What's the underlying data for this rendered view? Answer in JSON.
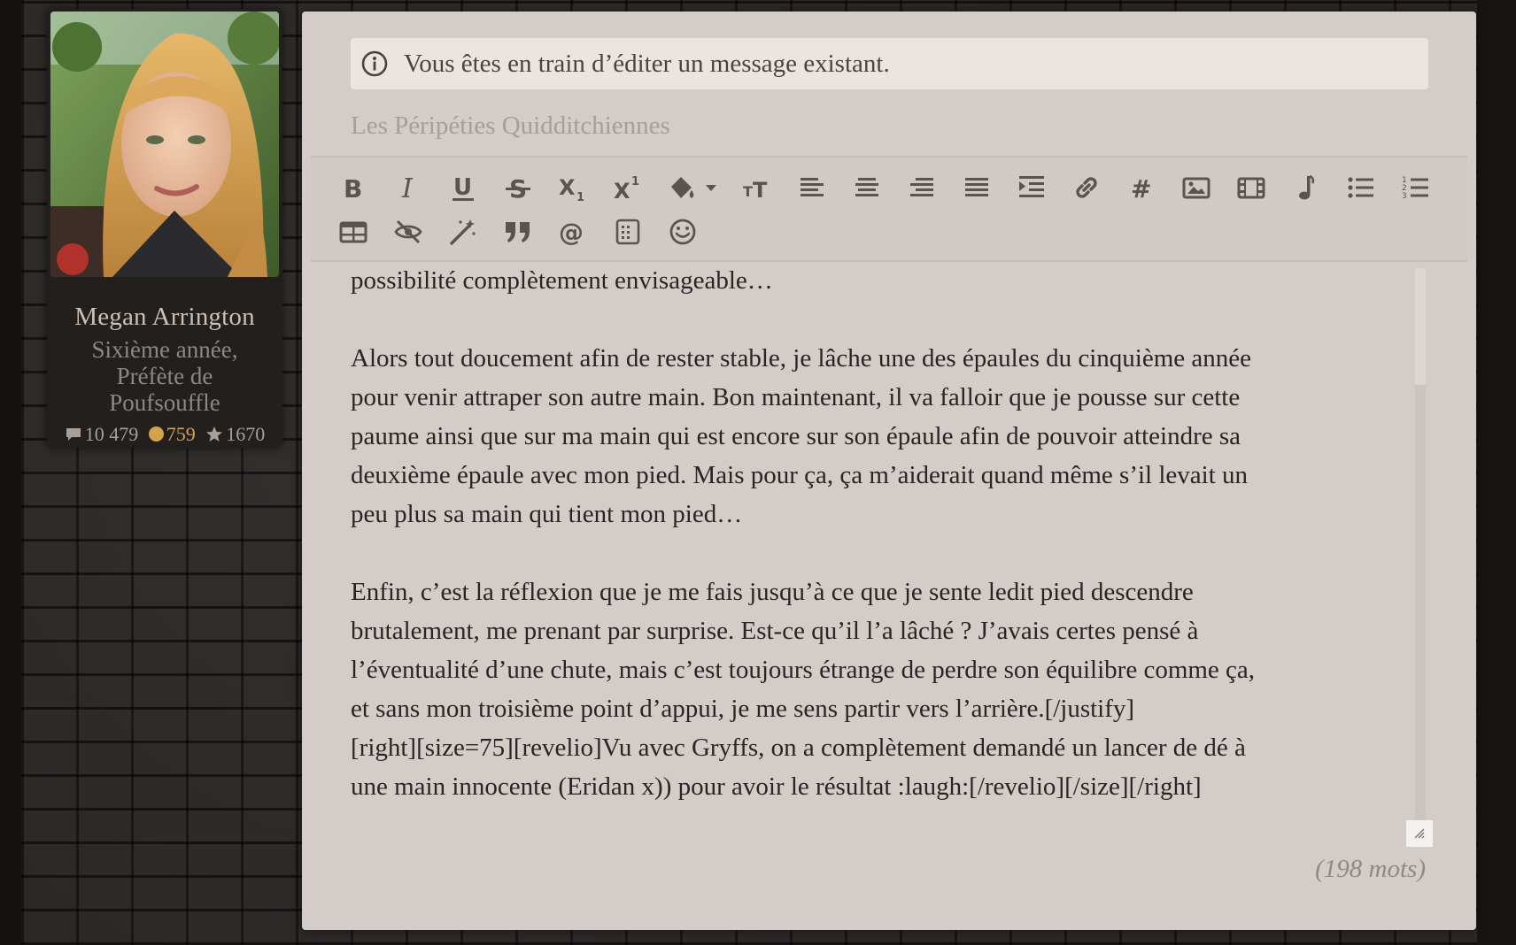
{
  "profile": {
    "name": "Megan Arrington",
    "rank": "Sixième année, Préfète de Poufsouffle",
    "stats": {
      "messages": "10 479",
      "coins": "759",
      "points": "1670"
    }
  },
  "editor": {
    "notice": "Vous êtes en train d’éditer un message existant.",
    "subject": "Les Péripéties Quidditchiennes",
    "toolbar": [
      "bold-icon",
      "italic-icon",
      "underline-icon",
      "strikethrough-icon",
      "subscript-icon",
      "superscript-icon",
      "fill-color-icon",
      "font-size-icon",
      "align-left-icon",
      "align-center-icon",
      "align-right-icon",
      "align-justify-icon",
      "indent-icon",
      "link-icon",
      "hashtag-icon",
      "image-icon",
      "video-icon",
      "music-icon",
      "bullet-list-icon",
      "numbered-list-icon",
      "table-icon",
      "hide-icon",
      "magic-wand-icon",
      "quote-icon",
      "mention-icon",
      "spoiler-icon",
      "emoji-icon"
    ],
    "body": "possibilité complètement envisageable…\n\nAlors tout doucement afin de rester stable, je lâche une des épaules du cinquième année\npour venir attraper son autre main. Bon maintenant, il va falloir que je pousse sur cette\npaume ainsi que sur ma main qui est encore sur son épaule afin de pouvoir atteindre sa\ndeuxième épaule avec mon pied. Mais pour ça, ça m’aiderait quand même s’il levait un\npeu plus sa main qui tient mon pied…\n\nEnfin, c’est la réflexion que je me fais jusqu’à ce que je sente ledit pied descendre\nbrutalement, me prenant par surprise. Est-ce qu’il l’a lâché ? J’avais certes pensé à\nl’éventualité d’une chute, mais c’est toujours étrange de perdre son équilibre comme ça,\net sans mon troisième point d’appui, je me sens partir vers l’arrière.[/justify]\n[right][size=75][revelio]Vu avec Gryffs, on a complètement demandé un lancer de dé à\nune main innocente (Eridan x)) pour avoir le résultat :laugh:[/revelio][/size][/right]",
    "word_count": "(198 mots)"
  }
}
